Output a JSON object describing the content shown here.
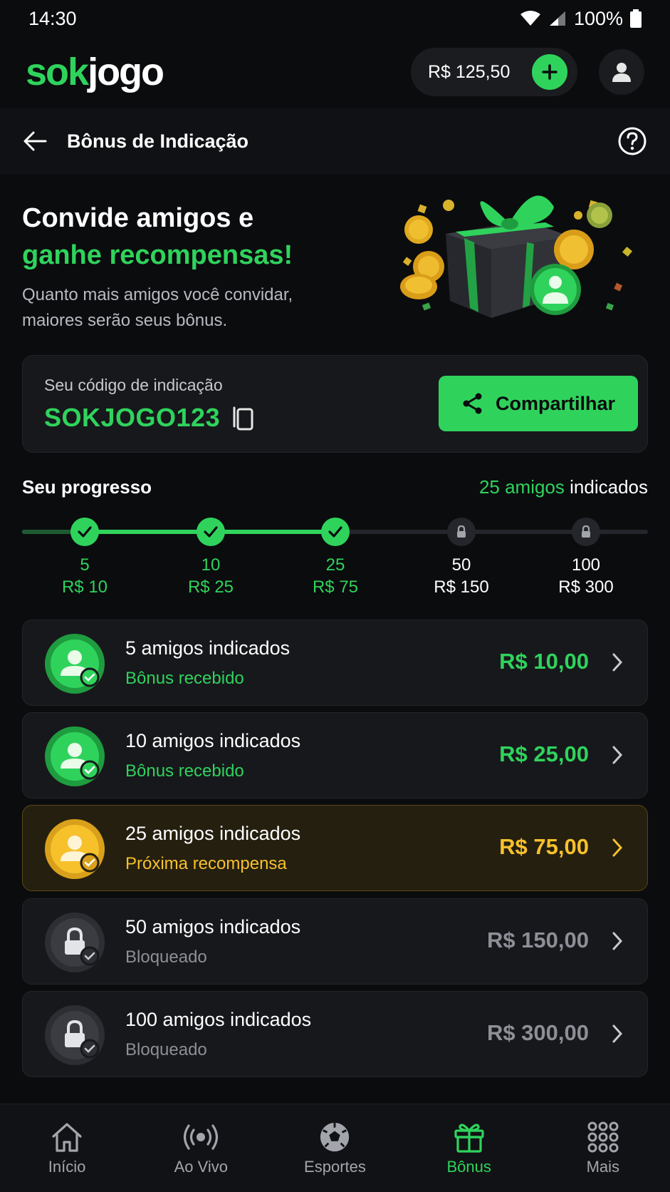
{
  "status_bar": {
    "time": "14:30",
    "battery": "100%"
  },
  "header": {
    "logo_part1": "sok",
    "logo_part2": "jogo",
    "balance": "R$ 125,50"
  },
  "subheader": {
    "title": "Bônus de Indicação"
  },
  "hero": {
    "title_line1": "Convide amigos e",
    "title_line2": "ganhe recompensas!",
    "subtitle": "Quanto mais amigos você convidar, maiores serão seus bônus."
  },
  "referral": {
    "label": "Seu código de indicação",
    "code": "SOKJOGO123",
    "share_label": "Compartilhar"
  },
  "progress": {
    "title": "Seu progresso",
    "count_number": "25 amigos",
    "count_suffix": "indicados",
    "fill_fraction": 0.5,
    "milestones": [
      {
        "count": "5",
        "reward": "R$ 10",
        "state": "achieved"
      },
      {
        "count": "10",
        "reward": "R$ 25",
        "state": "achieved"
      },
      {
        "count": "25",
        "reward": "R$ 75",
        "state": "achieved"
      },
      {
        "count": "50",
        "reward": "R$ 150",
        "state": "locked"
      },
      {
        "count": "100",
        "reward": "R$ 300",
        "state": "locked"
      }
    ]
  },
  "tiers": [
    {
      "title": "5 amigos indicados",
      "status": "Bônus recebido",
      "amount": "R$ 10,00",
      "state": "received"
    },
    {
      "title": "10 amigos indicados",
      "status": "Bônus recebido",
      "amount": "R$ 25,00",
      "state": "received"
    },
    {
      "title": "25 amigos indicados",
      "status": "Próxima recompensa",
      "amount": "R$ 75,00",
      "state": "next"
    },
    {
      "title": "50 amigos indicados",
      "status": "Bloqueado",
      "amount": "R$ 150,00",
      "state": "locked"
    },
    {
      "title": "100 amigos indicados",
      "status": "Bloqueado",
      "amount": "R$ 300,00",
      "state": "locked"
    }
  ],
  "nav": {
    "items": [
      {
        "label": "Início",
        "icon": "home-icon"
      },
      {
        "label": "Ao Vivo",
        "icon": "live-broadcast-icon"
      },
      {
        "label": "Esportes",
        "icon": "soccer-ball-icon"
      },
      {
        "label": "Bônus",
        "icon": "gift-icon",
        "active": true
      },
      {
        "label": "Mais",
        "icon": "grid-dots-icon"
      }
    ]
  },
  "colors": {
    "accent": "#2fd35c",
    "gold": "#f6c12b",
    "background": "#0b0c0e",
    "card": "#17181c",
    "muted": "#8c8f96"
  }
}
